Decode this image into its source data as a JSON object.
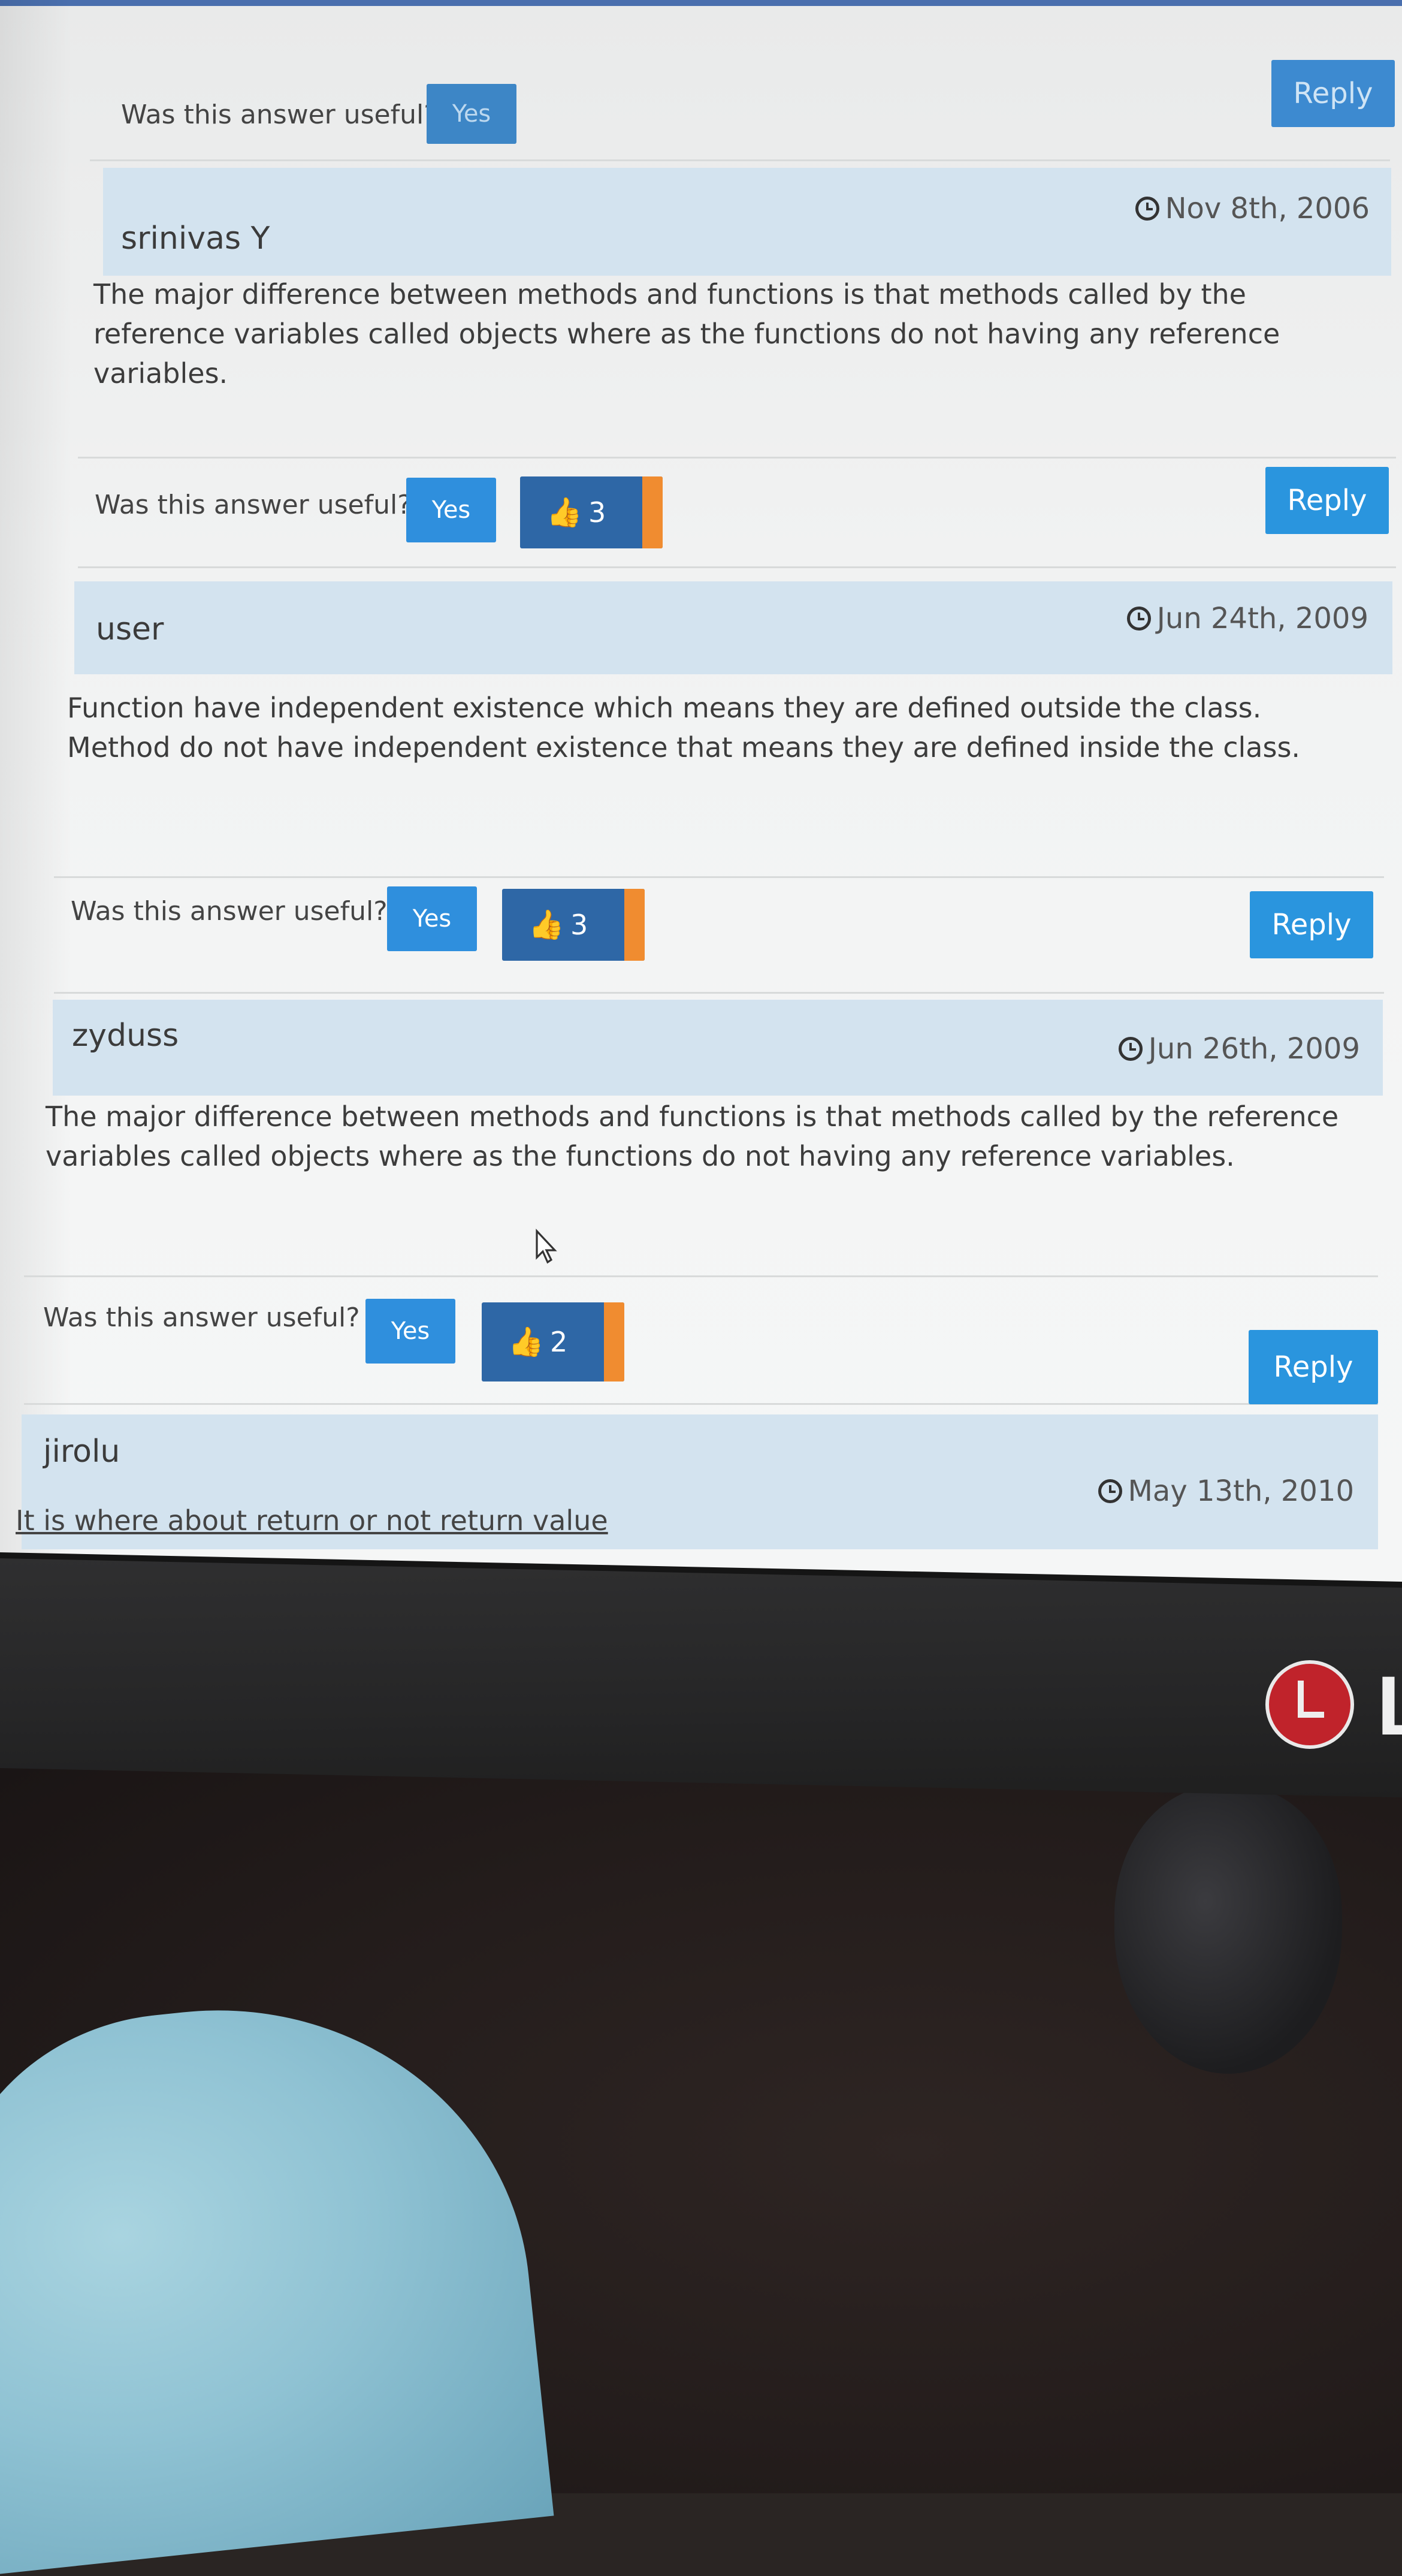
{
  "question_label": "Was this answer useful?",
  "yes_label": "Yes",
  "reply_label": "Reply",
  "brand": {
    "letter": "L",
    "logo_color": "#c0232b"
  },
  "colors": {
    "button_blue": "#2a95de",
    "vote_badge": "#2e67a6",
    "vote_accent": "#f08c30",
    "author_bar": "#d3e3ef"
  },
  "icons": {
    "date": "clock-icon",
    "vote": "thumbs-up-icon",
    "pointer": "mouse-cursor-icon"
  },
  "answers": [
    {
      "author": "srinivas Y",
      "date": "Nov 8th, 2006",
      "text": "The major difference between methods and functions is that methods called by the reference variables called objects where as the functions do not having any reference variables.",
      "votes": "3"
    },
    {
      "author": "user",
      "date": "Jun 24th, 2009",
      "text": "Function have independent existence which means they are defined outside the class. Method do not have independent existence that means they are defined inside the class.",
      "votes": "3"
    },
    {
      "author": "zyduss",
      "date": "Jun 26th, 2009",
      "text": "The major difference between methods and functions is that methods called by the reference variables called objects where as the functions do not having any reference variables.",
      "votes": "2"
    },
    {
      "author": "jirolu",
      "date": "May 13th, 2010",
      "text": "It is where about return or not return value"
    }
  ]
}
